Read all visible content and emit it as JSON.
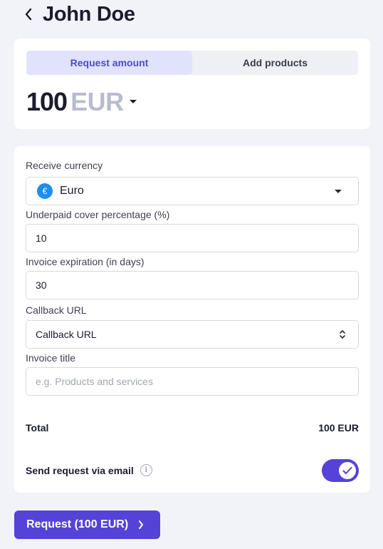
{
  "header": {
    "title": "John Doe",
    "back_icon": "chevron-left-icon"
  },
  "amount_card": {
    "tabs": [
      {
        "label": "Request amount",
        "active": true
      },
      {
        "label": "Add products",
        "active": false
      }
    ],
    "amount": "100",
    "currency": "EUR"
  },
  "form": {
    "receive_currency": {
      "label": "Receive currency",
      "value": "Euro",
      "icon_symbol": "€"
    },
    "underpaid_cover": {
      "label": "Underpaid cover percentage (%)",
      "value": "10"
    },
    "invoice_expiration": {
      "label": "Invoice expiration (in days)",
      "value": "30"
    },
    "callback_url": {
      "label": "Callback URL",
      "value": "Callback URL"
    },
    "invoice_title": {
      "label": "Invoice title",
      "placeholder": "e.g. Products and services",
      "value": ""
    },
    "total": {
      "label": "Total",
      "value": "100 EUR"
    },
    "send_email": {
      "label": "Send request via email",
      "info_symbol": "i",
      "enabled": true
    }
  },
  "submit": {
    "label": "Request (100 EUR)"
  },
  "colors": {
    "accent": "#5543d8",
    "tab_active_bg": "#e1e2fc",
    "tab_active_text": "#4a4fc1",
    "euro_badge": "#1b8ef2"
  }
}
